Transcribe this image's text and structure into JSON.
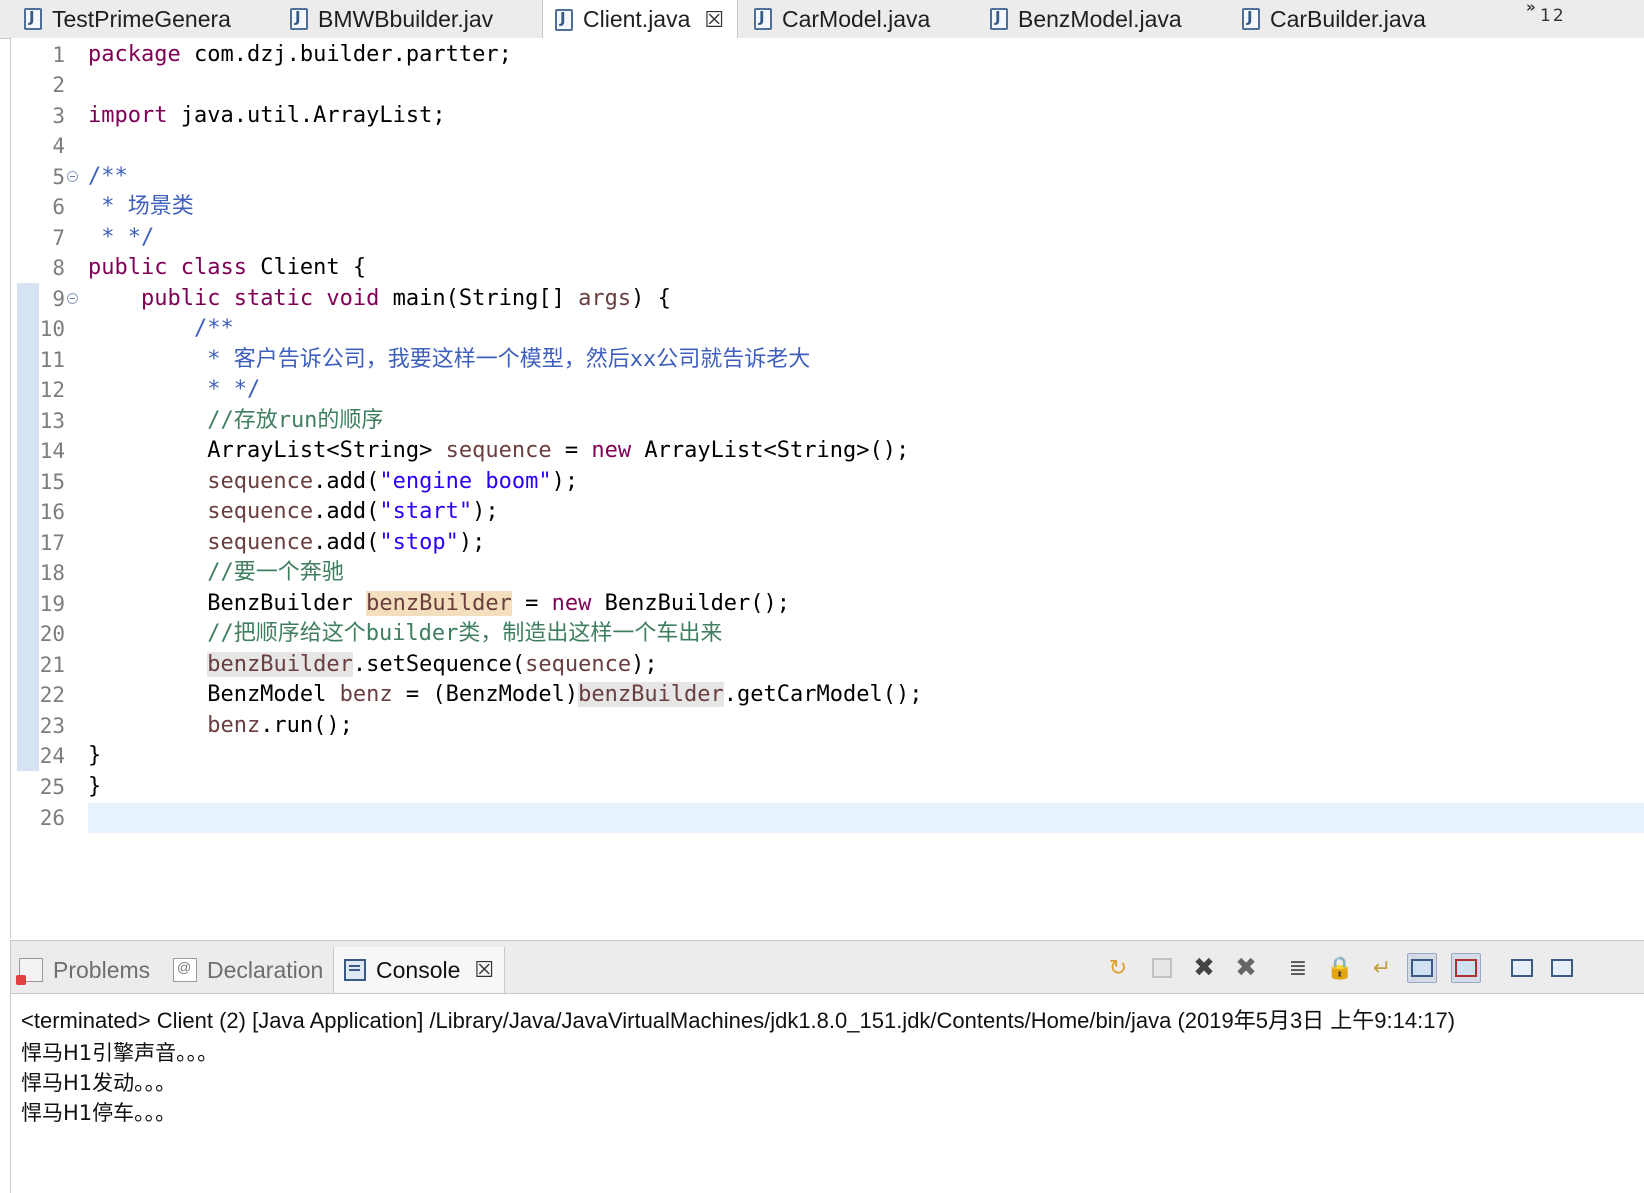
{
  "editor_tabs": [
    {
      "label": "TestPrimeGenera",
      "active": false
    },
    {
      "label": "BMWBbuilder.jav",
      "active": false
    },
    {
      "label": "Client.java",
      "active": true
    },
    {
      "label": "CarModel.java",
      "active": false
    },
    {
      "label": "BenzModel.java",
      "active": false
    },
    {
      "label": "CarBuilder.java",
      "active": false
    }
  ],
  "overflow": {
    "chevron": "»",
    "count": "12"
  },
  "editor": {
    "line_numbers": [
      "1",
      "2",
      "3",
      "4",
      "5",
      "6",
      "7",
      "8",
      "9",
      "10",
      "11",
      "12",
      "13",
      "14",
      "15",
      "16",
      "17",
      "18",
      "19",
      "20",
      "21",
      "22",
      "23",
      "24",
      "25",
      "26"
    ],
    "tokens": {
      "l1_kw": "package",
      "l1_rest": " com.dzj.builder.partter;",
      "l3_kw": "import",
      "l3_rest": " java.util.ArrayList;",
      "l5": "/**",
      "l6": " * 场景类",
      "l7": " * */",
      "l8_kw": "public class",
      "l8_rest": " Client {",
      "l9_indent": "    ",
      "l9_kw": "public static void",
      "l9_a": " main(String[] ",
      "l9_args": "args",
      "l9_b": ") {",
      "l10": "        /**",
      "l11": "         * 客户告诉公司，我要这样一个模型，然后xx公司就告诉老大",
      "l12": "         * */",
      "l13": "         //存放run的顺序",
      "l14_a": "         ArrayList<String> ",
      "l14_var": "sequence",
      "l14_b": " = ",
      "l14_kw": "new",
      "l14_c": " ArrayList<String>();",
      "l15_var": "         sequence",
      "l15_a": ".add(",
      "l15_str": "\"engine boom\"",
      "l15_b": ");",
      "l16_var": "         sequence",
      "l16_a": ".add(",
      "l16_str": "\"start\"",
      "l16_b": ");",
      "l17_var": "         sequence",
      "l17_a": ".add(",
      "l17_str": "\"stop\"",
      "l17_b": ");",
      "l18": "         //要一个奔驰",
      "l19_a": "         BenzBuilder ",
      "l19_var": "benzBuilder",
      "l19_b": " = ",
      "l19_kw": "new",
      "l19_c": " BenzBuilder();",
      "l20": "         //把顺序给这个builder类，制造出这样一个车出来",
      "l21_pre": "         ",
      "l21_var": "benzBuilder",
      "l21_a": ".setSequence(",
      "l21_arg": "sequence",
      "l21_b": ");",
      "l22_a": "         BenzModel ",
      "l22_var": "benz",
      "l22_b": " = (BenzModel)",
      "l22_var2": "benzBuilder",
      "l22_c": ".getCarModel();",
      "l23_var": "         benz",
      "l23_a": ".run();",
      "l24": "}",
      "l25": "}"
    }
  },
  "panel_tabs": [
    {
      "label": "Problems",
      "active": false
    },
    {
      "label": "Declaration",
      "active": false
    },
    {
      "label": "Console",
      "active": true
    }
  ],
  "console": {
    "header": "<terminated> Client (2) [Java Application] /Library/Java/JavaVirtualMachines/jdk1.8.0_151.jdk/Contents/Home/bin/java (2019年5月3日 上午9:14:17)",
    "output": [
      "悍马H1引擎声音。。。",
      "悍马H1发动。。。",
      "悍马H1停车。。。"
    ]
  },
  "toolbar_icons": [
    "pin-icon",
    "terminate-icon",
    "remove-launch-icon",
    "remove-all-icon",
    "clear-console-icon",
    "scroll-lock-icon",
    "word-wrap-icon",
    "show-on-stdout-icon",
    "show-on-stderr-icon",
    "open-console-icon",
    "display-console-icon"
  ],
  "colors": {
    "keyword": "#7f0055",
    "string": "#2a00ff",
    "comment": "#3f7f5f",
    "javadoc": "#3f5fbf",
    "local_var": "#6a3e3e",
    "highlight": "#f3dfbd"
  }
}
